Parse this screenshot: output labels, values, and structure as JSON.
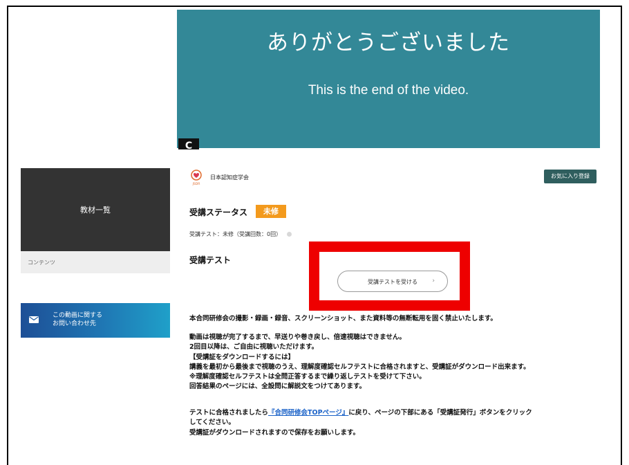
{
  "video": {
    "title": "ありがとうございました",
    "subtitle": "This is the end of the video.",
    "replay_icon": "replay-icon",
    "replay_glyph": "C"
  },
  "sidebar": {
    "materials_label": "教材一覧",
    "contents_label": "コンテンツ",
    "contact_line1": "この動画に関する",
    "contact_line2": "お問い合わせ先",
    "contact_icon": "mail-icon"
  },
  "header": {
    "org_name": "日本認知症学会",
    "logo_text": "JSDR",
    "favorite_button": "お気に入り登録"
  },
  "status": {
    "label": "受講ステータス",
    "badge": "未修",
    "test_status": "受講テスト：未修（受講回数：0回）"
  },
  "test": {
    "heading": "受講テスト",
    "button_label": "受講テストを受ける",
    "button_arrow": "›"
  },
  "notice": "本合同研修会の撮影・録画・録音、スクリーンショット、また資料等の無断転用を固く禁止いたします。",
  "info_lines": [
    "動画は視聴が完了するまで、早送りや巻き戻し、倍速視聴はできません。",
    "2回目以降は、ご自由に視聴いただけます。",
    "【受講証をダウンロードするには】",
    "講義を最初から最後まで視聴のうえ、理解度確認セルフテストに合格されますと、受講証がダウンロード出来ます。",
    "※理解度確認セルフテストは全問正答するまで繰り返しテストを受けて下さい。",
    "回答結果のページには、全設問に解説文をつけてあります。"
  ],
  "para2": {
    "before_link": "テストに合格されましたら",
    "link_text": "『合同研修会TOPページ』",
    "after_link": "に戻り、ページの下部にある「受講証発行」ボタンをクリック",
    "line2": "してください。",
    "line3": "受講証がダウンロードされますので保存をお願いします。"
  },
  "colors": {
    "video_bg": "#338897",
    "badge": "#f39a1d",
    "favorite_btn": "#2f5e5e",
    "highlight_box": "#ee0000",
    "link": "#1a62c8"
  }
}
